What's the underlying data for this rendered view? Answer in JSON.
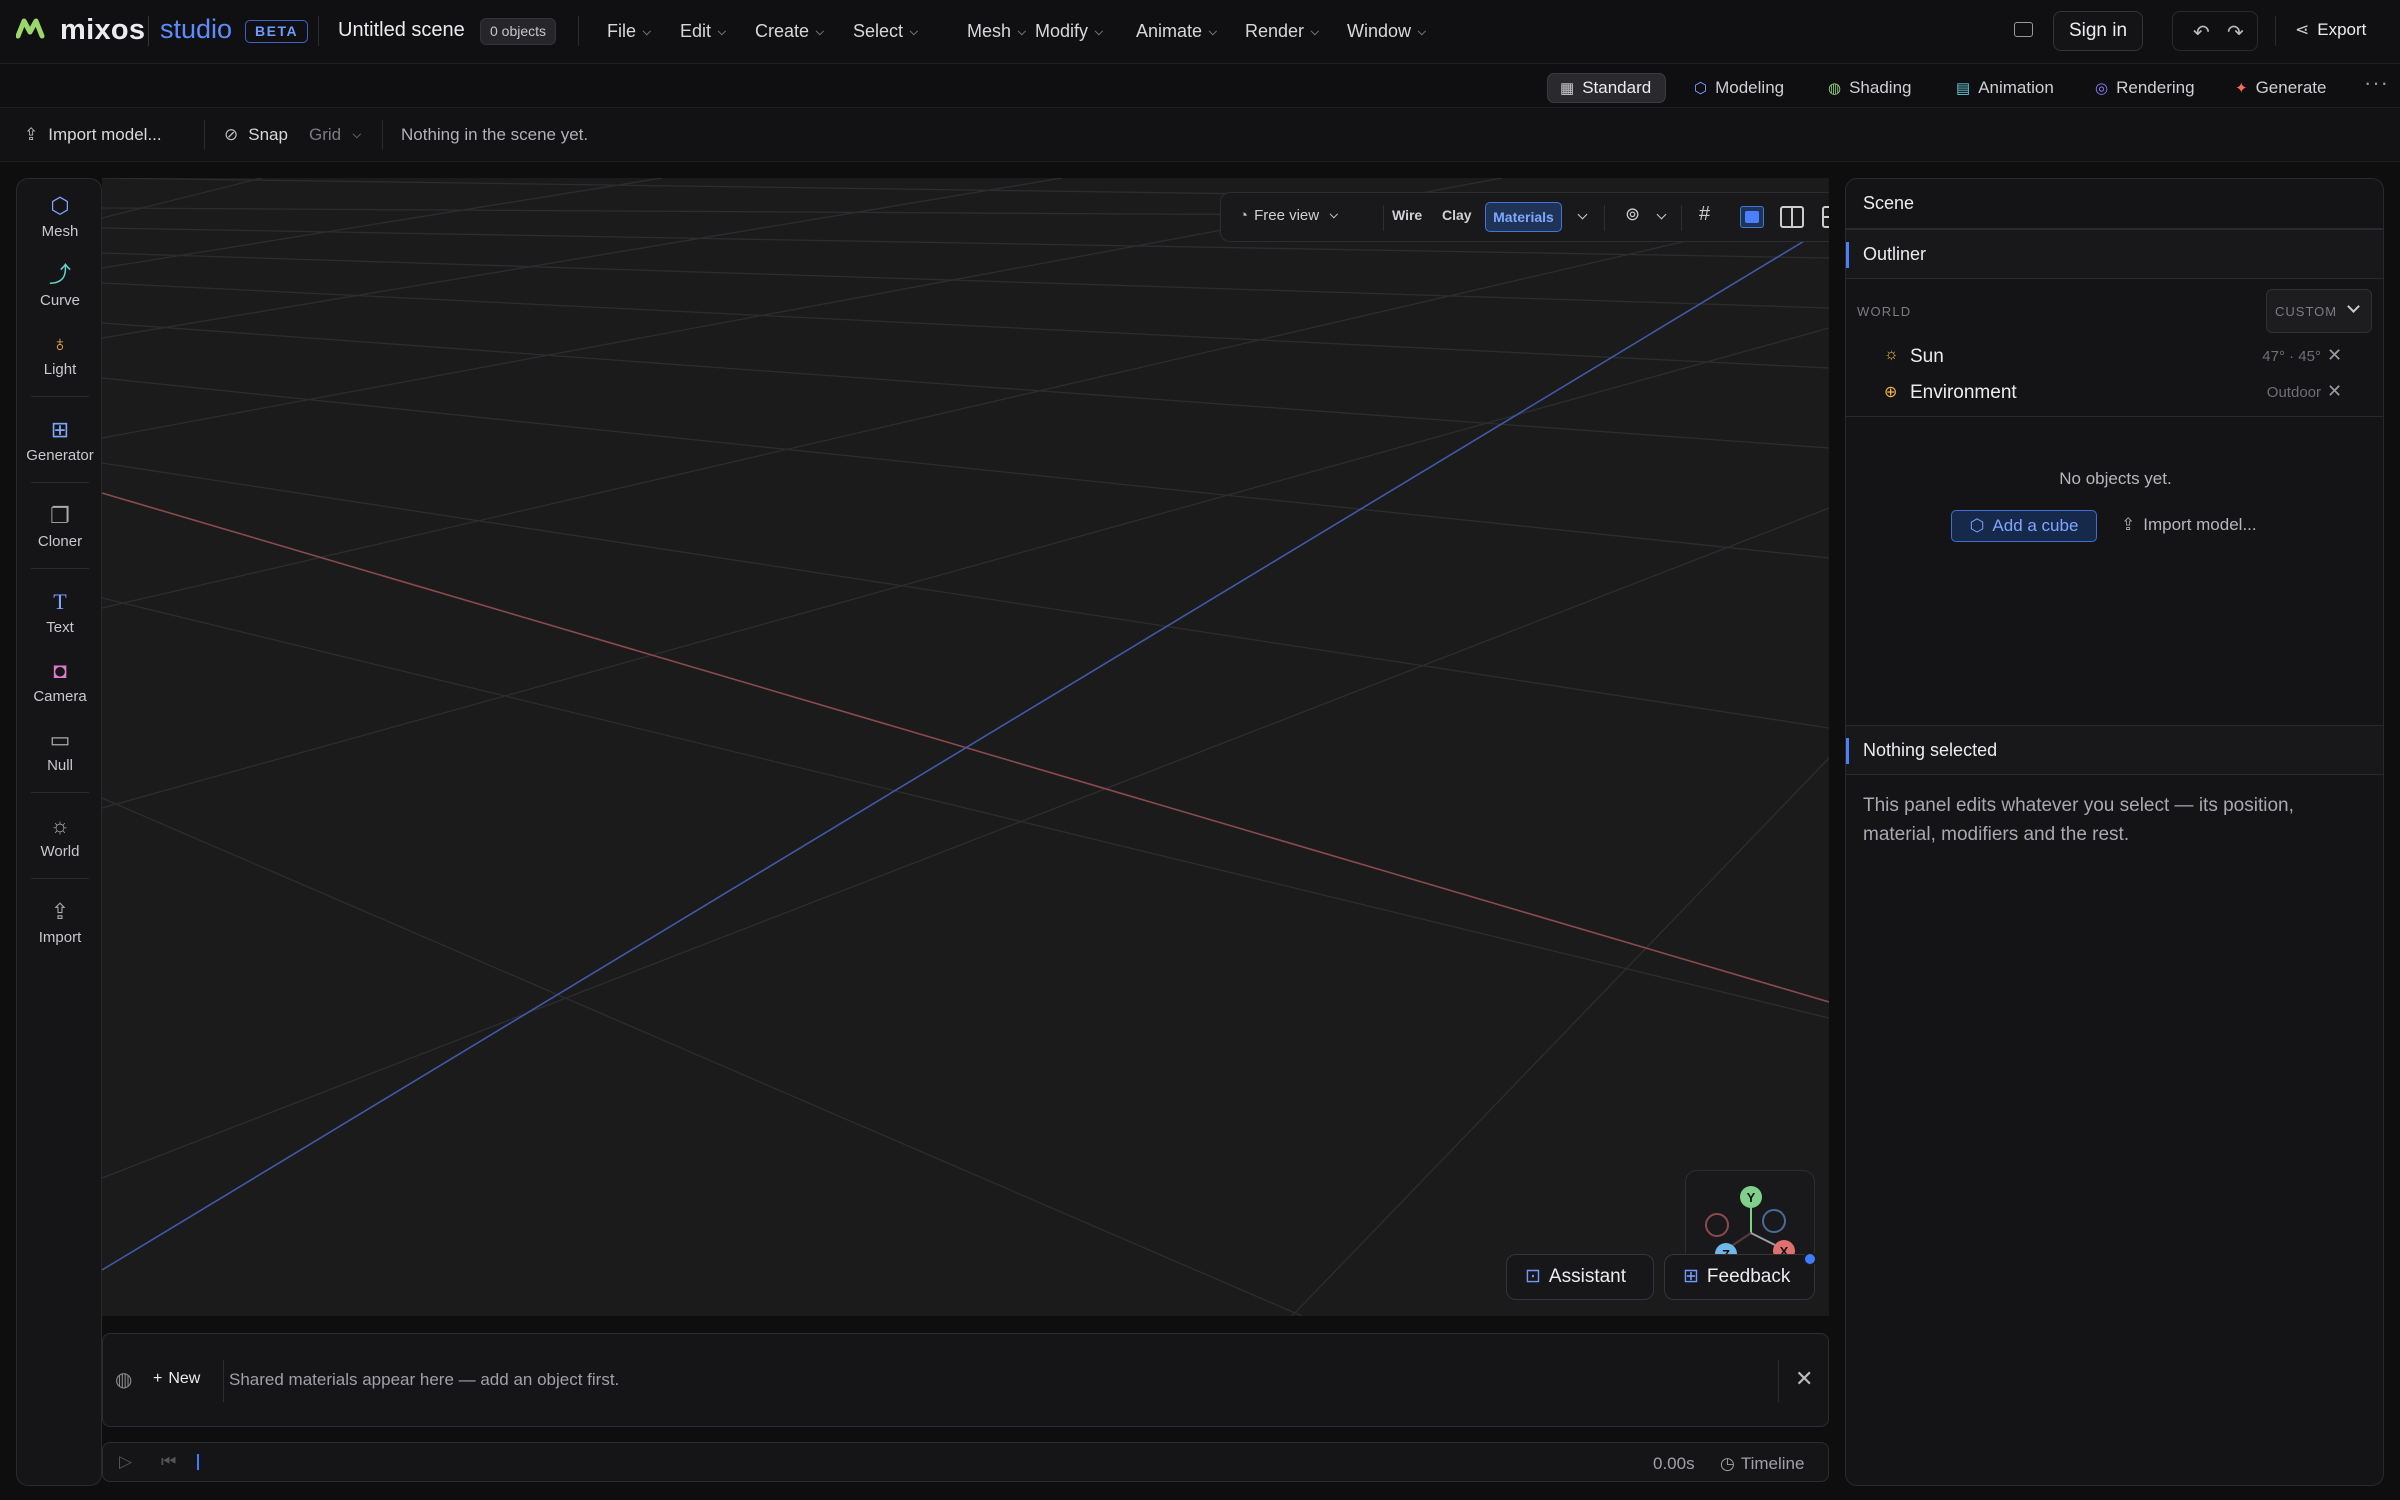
{
  "app": {
    "logo_text": "mixos",
    "product": "studio",
    "badge": "BETA",
    "scene_title": "Untitled scene",
    "object_count": "0 objects",
    "accent": "#4a7fff"
  },
  "menus": [
    "File",
    "Edit",
    "Create",
    "Select",
    "Mesh",
    "Modify",
    "Animate",
    "Render",
    "Window"
  ],
  "top_right": {
    "signin": "Sign in",
    "export": "Export"
  },
  "modes": [
    {
      "label": "Standard",
      "active": true
    },
    {
      "label": "Modeling"
    },
    {
      "label": "Shading"
    },
    {
      "label": "Animation"
    },
    {
      "label": "Rendering"
    },
    {
      "label": "Generate"
    }
  ],
  "toolbar": {
    "import": "Import model...",
    "snap": "Snap",
    "grid": "Grid",
    "status": "Nothing in the scene yet."
  },
  "tools": [
    "Mesh",
    "Curve",
    "Light",
    "Generator",
    "Cloner",
    "Text",
    "Camera",
    "Null",
    "World",
    "Import"
  ],
  "viewport": {
    "view_mode": "Free view",
    "shading": [
      "Wire",
      "Clay",
      "Materials"
    ],
    "active_shading": "Materials",
    "gizmo_axes": [
      "Y",
      "Z",
      "X"
    ],
    "assistant": "Assistant",
    "feedback": "Feedback"
  },
  "materials": {
    "new": "New",
    "hint": "Shared materials appear here — add an object first."
  },
  "timeline": {
    "time": "0.00s",
    "label": "Timeline"
  },
  "panel": {
    "title": "Scene",
    "outliner": "Outliner",
    "world_label": "WORLD",
    "world_preset": "CUSTOM",
    "world_items": [
      {
        "name": "Sun",
        "value": "47° · 45°",
        "icon": "sun-icon"
      },
      {
        "name": "Environment",
        "value": "Outdoor",
        "icon": "globe-icon"
      }
    ],
    "empty": "No objects yet.",
    "add_cube": "Add a cube",
    "import_model": "Import model...",
    "selection_title": "Nothing selected",
    "selection_text": "This panel edits whatever you select — its position, material, modifiers and the rest."
  }
}
